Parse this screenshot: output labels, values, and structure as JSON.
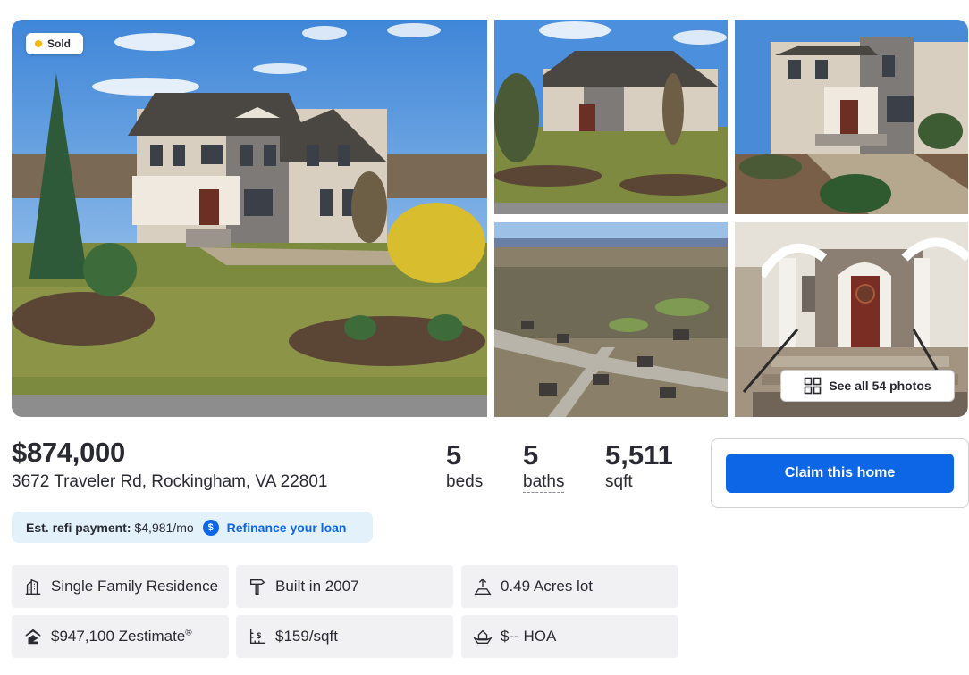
{
  "listing": {
    "status_badge": "Sold",
    "see_all_photos": "See all 54 photos",
    "price": "$874,000",
    "address": "3672 Traveler Rd, Rockingham, VA 22801"
  },
  "stats": {
    "beds_value": "5",
    "beds_label": "beds",
    "baths_value": "5",
    "baths_label": "baths",
    "sqft_value": "5,511",
    "sqft_label": "sqft"
  },
  "claim": {
    "button_label": "Claim this home"
  },
  "refi": {
    "label": "Est. refi payment:",
    "amount": "$4,981/mo",
    "icon_glyph": "$",
    "link": "Refinance your loan"
  },
  "facts": {
    "type": "Single Family Residence",
    "built": "Built in 2007",
    "lot": "0.49 Acres lot",
    "zestimate": "$947,100 Zestimate",
    "zestimate_mark": "®",
    "price_per_sqft": "$159/sqft",
    "hoa": "$-- HOA"
  },
  "icons": {
    "type": "building-icon",
    "built": "hammer-icon",
    "lot": "lot-size-icon",
    "zestimate": "zillow-logo-icon",
    "price_per_sqft": "price-per-sqft-icon",
    "hoa": "hoa-hands-icon",
    "see_all": "grid-icon"
  },
  "colors": {
    "accent": "#0d66e5",
    "sold_dot": "#f5b700",
    "refi_bg": "#e3f1fb",
    "fact_bg": "#f1f1f4"
  }
}
